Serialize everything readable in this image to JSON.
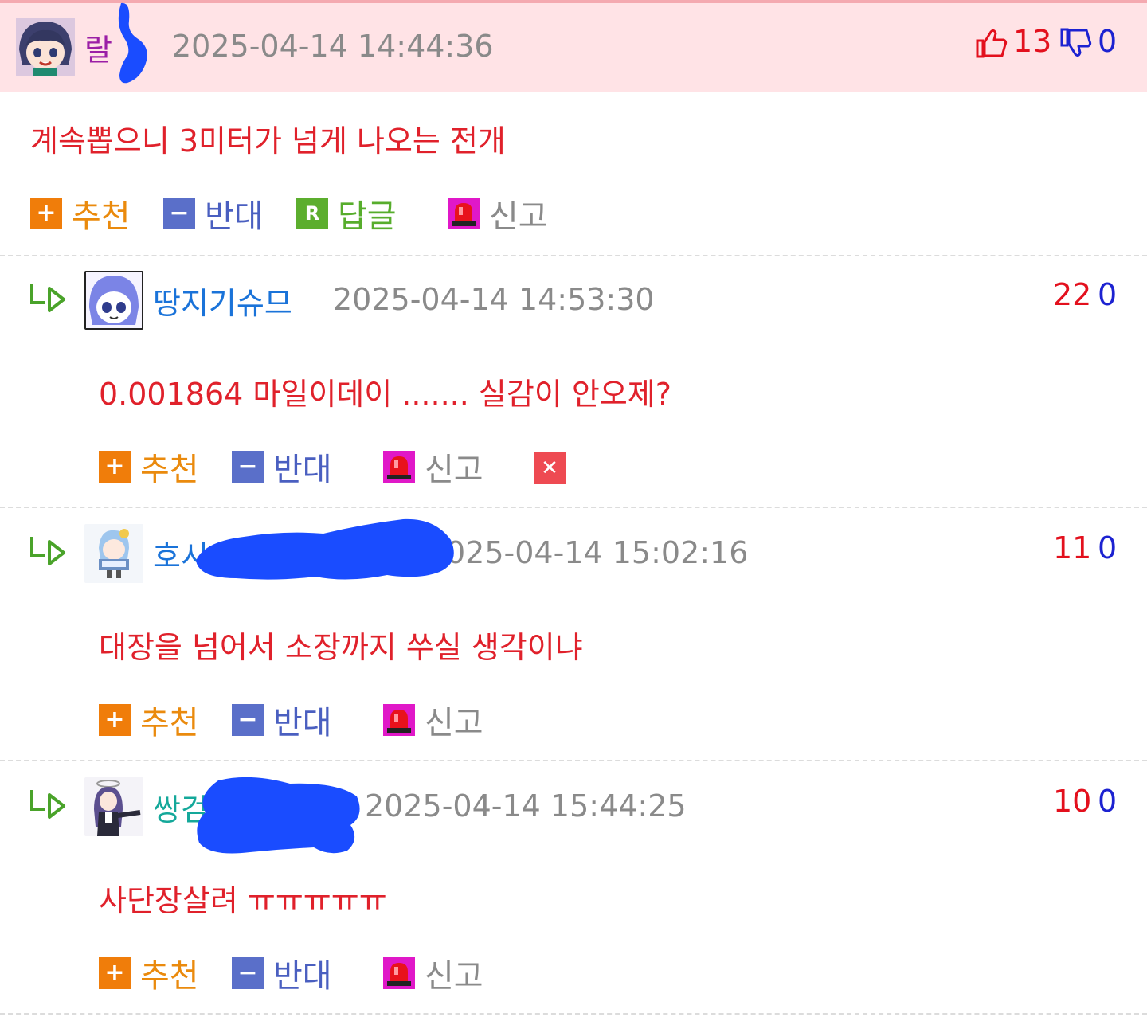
{
  "colors": {
    "header_bg": "#ffe3e6",
    "comment_text": "#e0212b",
    "time": "#8a8a8a",
    "up_label": "#ea8a0d",
    "down_label": "#4a5fc0",
    "reply_label": "#57ad2c",
    "vote_up": "#e3101d",
    "vote_down": "#1c22d1",
    "redaction": "#1a4cff"
  },
  "comments": [
    {
      "nickname": "랄",
      "nick_color": "#9b1fa6",
      "time": "2025-04-14 14:44:36",
      "text": "계속뽑으니 3미터가 넘게 나오는 전개",
      "up": "13",
      "down": "0",
      "actions": {
        "recommend": "추천",
        "oppose": "반대",
        "reply": "답글",
        "report": "신고",
        "reply_badge": "R"
      },
      "icons": [
        "thumbs-up-icon",
        "thumbs-down-icon"
      ]
    },
    {
      "nickname": "땅지기슈므",
      "nick_color": "#1a73d9",
      "time": "2025-04-14 14:53:30",
      "text": "0.001864 마일이데이 ....... 실감이 안오제?",
      "up": "22",
      "down": "0",
      "actions": {
        "recommend": "추천",
        "oppose": "반대",
        "report": "신고"
      },
      "icons": [
        "reply-arrow-icon",
        "delete-icon"
      ]
    },
    {
      "nickname": "호시",
      "nick_color": "#1a73d9",
      "time": "025-04-14 15:02:16",
      "text": "대장을 넘어서 소장까지 쑤실 생각이냐",
      "up": "11",
      "down": "0",
      "actions": {
        "recommend": "추천",
        "oppose": "반대",
        "report": "신고"
      }
    },
    {
      "nickname": "쌍검",
      "nick_color": "#14a89a",
      "time": "2025-04-14 15:44:25",
      "text": "사단장살려 ㅠㅠㅠㅠㅠ",
      "up": "10",
      "down": "0",
      "actions": {
        "recommend": "추천",
        "oppose": "반대",
        "report": "신고"
      }
    }
  ]
}
